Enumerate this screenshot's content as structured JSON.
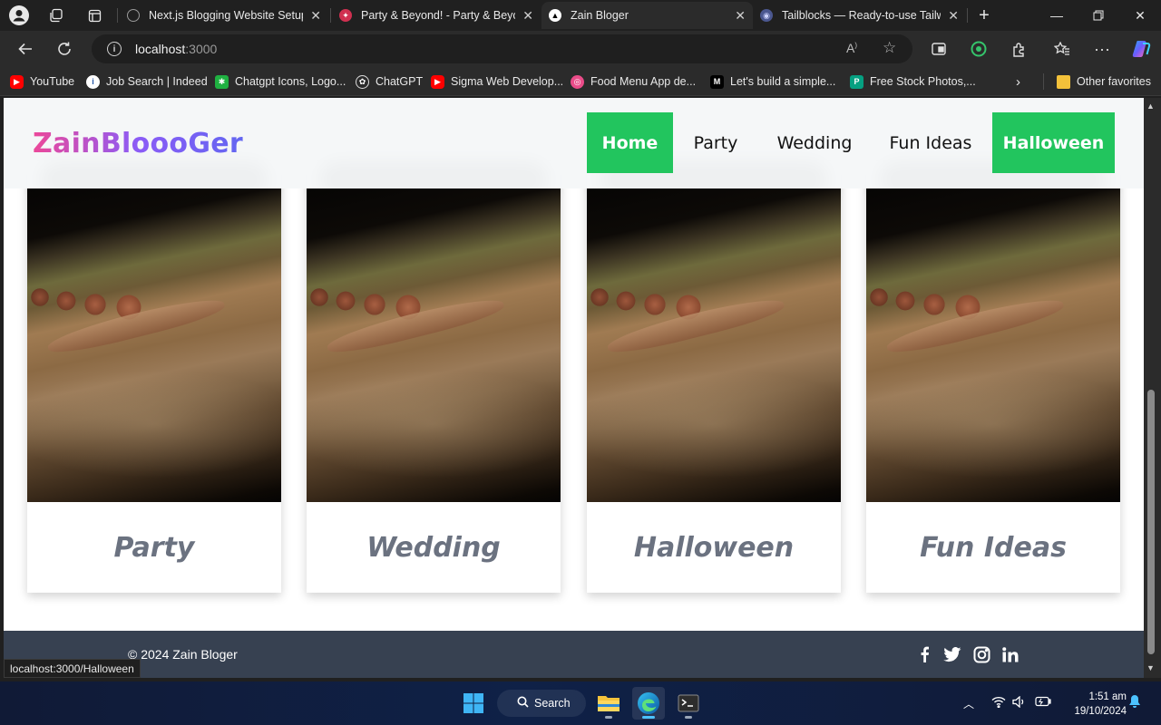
{
  "browser": {
    "tabs": [
      {
        "title": "Next.js Blogging Website Setup",
        "active": false
      },
      {
        "title": "Party & Beyond! - Party & Beyon",
        "active": false
      },
      {
        "title": "Zain Bloger",
        "active": true
      },
      {
        "title": "Tailblocks — Ready-to-use Tailwi",
        "active": false
      }
    ],
    "address": {
      "host": "localhost",
      "port": ":3000"
    },
    "favorites": [
      {
        "label": "YouTube"
      },
      {
        "label": "Job Search | Indeed"
      },
      {
        "label": "Chatgpt Icons, Logo..."
      },
      {
        "label": "ChatGPT"
      },
      {
        "label": "Sigma Web Develop..."
      },
      {
        "label": "Food Menu App de..."
      },
      {
        "label": "Let's build a simple..."
      },
      {
        "label": "Free Stock Photos,..."
      }
    ],
    "other_favorites": "Other favorites",
    "status_url": "localhost:3000/Halloween"
  },
  "site": {
    "logo": "ZainBloooGer",
    "nav": [
      {
        "label": "Home",
        "highlighted": true
      },
      {
        "label": "Party",
        "highlighted": false
      },
      {
        "label": "Wedding",
        "highlighted": false
      },
      {
        "label": "Fun Ideas",
        "highlighted": false
      },
      {
        "label": "Halloween",
        "highlighted": true
      }
    ],
    "accent_color": "#22c55e",
    "cards": [
      {
        "label": "Party"
      },
      {
        "label": "Wedding"
      },
      {
        "label": "Halloween"
      },
      {
        "label": "Fun Ideas"
      }
    ],
    "footer": {
      "copyright": "© 2024 Zain Bloger",
      "social_icons": [
        "facebook-icon",
        "twitter-icon",
        "instagram-icon",
        "linkedin-icon"
      ],
      "background": "#374151"
    }
  },
  "taskbar": {
    "search_label": "Search",
    "time": "1:51 am",
    "date": "19/10/2024"
  }
}
